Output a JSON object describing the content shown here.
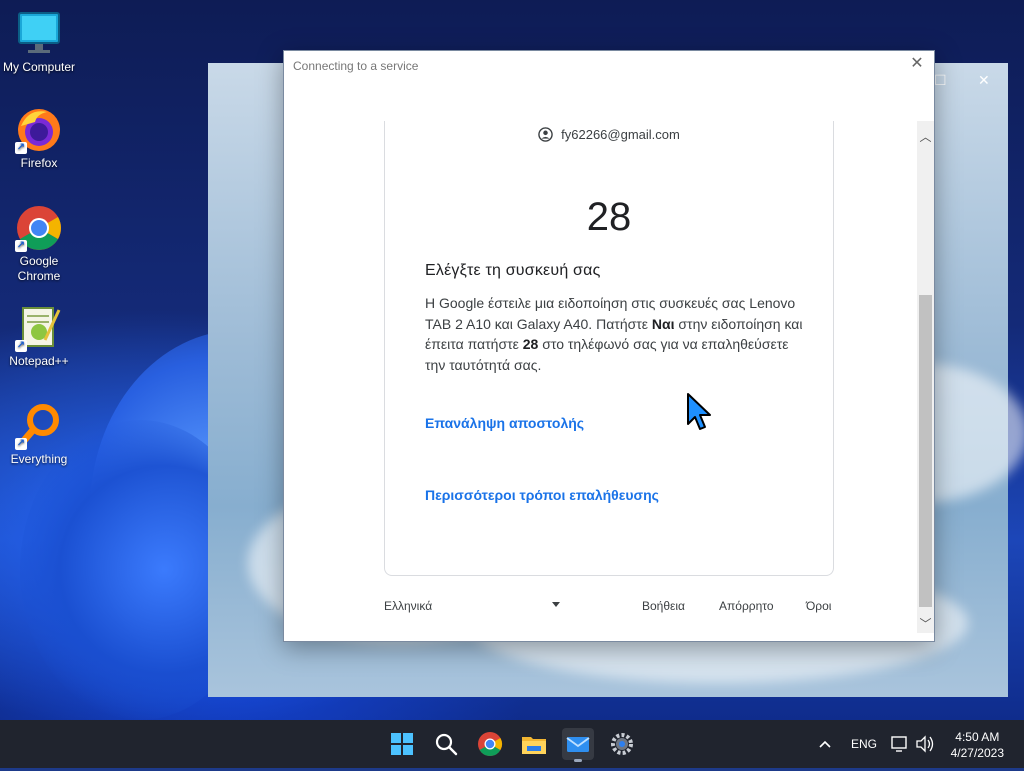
{
  "desktop": {
    "icons": [
      {
        "label": "My Computer",
        "icon": "monitor-icon"
      },
      {
        "label": "Firefox",
        "icon": "firefox-icon"
      },
      {
        "label": "Google Chrome",
        "icon": "chrome-icon"
      },
      {
        "label": "Notepad++",
        "icon": "notepadpp-icon"
      },
      {
        "label": "Everything",
        "icon": "everything-search-icon"
      }
    ]
  },
  "dialog": {
    "title": "Connecting to a service",
    "close_icon": "close-icon",
    "account_email": "fy62266@gmail.com",
    "code": "28",
    "heading": "Ελέγξτε τη συσκευή σας",
    "body": {
      "part1": "Η Google έστειλε μια ειδοποίηση στις συσκευές σας Lenovo TAB 2 A10 και Galaxy A40. Πατήστε ",
      "bold1": "Ναι",
      "part2": " στην ειδοποίηση και έπειτα πατήστε ",
      "bold2": "28",
      "part3": " στο τηλέφωνό σας για να επαληθεύσετε την ταυτότητά σας."
    },
    "resend_link": "Επανάληψη αποστολής",
    "more_ways_link": "Περισσότεροι τρόποι επαλήθευσης",
    "footer": {
      "language": "Ελληνικά",
      "help": "Βοήθεια",
      "privacy": "Απόρρητο",
      "terms": "Όροι"
    }
  },
  "taskbar": {
    "apps": [
      "start-icon",
      "search-icon",
      "chrome-icon",
      "file-explorer-icon",
      "mail-icon",
      "settings-icon"
    ],
    "language": "ENG",
    "time": "4:50 AM",
    "date": "4/27/2023"
  },
  "colors": {
    "link": "#1a73e8",
    "taskbar": "#20242e"
  }
}
